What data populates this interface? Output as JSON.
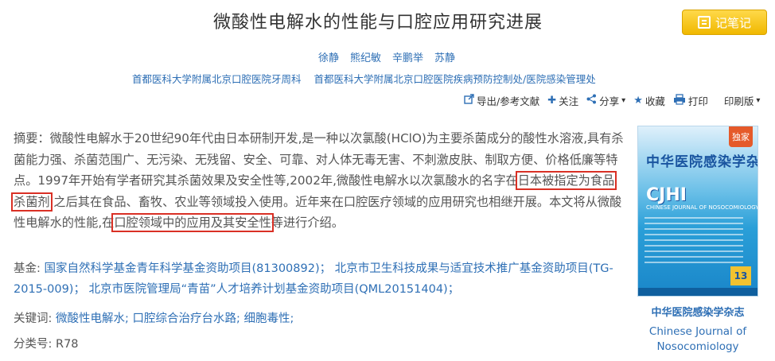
{
  "header": {
    "title": "微酸性电解水的性能与口腔应用研究进展",
    "note_button": "记笔记"
  },
  "authors": [
    "徐静",
    "熊纪敏",
    "辛鹏举",
    "苏静"
  ],
  "affiliations": [
    "首都医科大学附属北京口腔医院牙周科",
    "首都医科大学附属北京口腔医院疾病预防控制处/医院感染管理处"
  ],
  "actions": {
    "export": "导出/参考文献",
    "follow": "关注",
    "share": "分享",
    "favorite": "收藏",
    "print": "打印",
    "print_version": "印刷版"
  },
  "abstract": {
    "label": "摘要：",
    "part1": "微酸性电解水于20世纪90年代由日本研制开发,是一种以次氯酸(HClO)为主要杀菌成分的酸性水溶液,具有杀菌能力强、杀菌范围广、无污染、无残留、安全、可靠、对人体无毒无害、不刺激皮肤、制取方便、价格低廉等特点。1997年开始有学者研究其杀菌效果及安全性等,2002年,微酸性电解水以次氯酸水的名字在",
    "highlight1": "日本被指定为食品杀菌剂",
    "part2": ",之后其在食品、畜牧、农业等领域投入使用。近年来在口腔医疗领域的应用研究也相继开展。本文将从微酸性电解水的性能,在",
    "highlight2": "口腔领域中的应用及其安全性",
    "part3": "等进行介绍。"
  },
  "fund": {
    "label": "基金:",
    "item1": "国家自然科学基金青年科学基金资助项目(81300892)；",
    "item2": "北京市卫生科技成果与适宜技术推广基金资助项目(TG-2015-009)；",
    "item3": "北京市医院管理局“青苗”人才培养计划基金资助项目(QML20151404)；"
  },
  "keywords": {
    "label": "关键词:",
    "item1": "微酸性电解水;",
    "item2": "口腔综合治疗台水路;",
    "item3": "细胞毒性;"
  },
  "classification": {
    "label": "分类号:",
    "value": "R78"
  },
  "journal": {
    "cover_tag": "独家",
    "cover_title": "中华医院感染学杂志",
    "cover_abbr": "CJHI",
    "cover_en": "CHINESE JOURNAL OF NOSOCOMIOLOGY",
    "cover_issue": "13",
    "name_cn": "中华医院感染学杂志",
    "name_en": "Chinese Journal of Nosocomiology"
  },
  "colors": {
    "link": "#2e6fb5",
    "highlight_box": "#d93025",
    "note_button": "#f5c518"
  },
  "icons": [
    "note-icon",
    "export-icon",
    "follow-plus-icon",
    "share-icon",
    "star-icon",
    "printer-icon",
    "caret-down-icon"
  ]
}
